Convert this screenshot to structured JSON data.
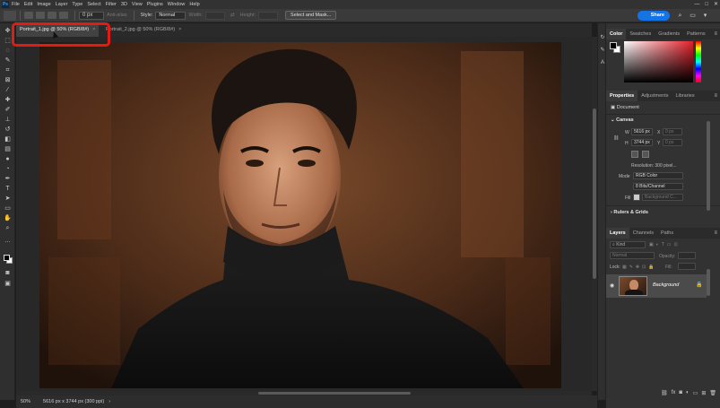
{
  "menu": {
    "logo": "Ps",
    "items": [
      "File",
      "Edit",
      "Image",
      "Layer",
      "Type",
      "Select",
      "Filter",
      "3D",
      "View",
      "Plugins",
      "Window",
      "Help"
    ],
    "window_controls": [
      "—",
      "□",
      "✕"
    ]
  },
  "options": {
    "feather_value": "0 px",
    "anti_alias": "Anti-alias",
    "style_label": "Style:",
    "style_value": "Normal",
    "width_label": "Width:",
    "height_label": "Height:",
    "select_mask": "Select and Mask...",
    "share": "Share"
  },
  "tabs": [
    {
      "label": "Portrait_1.jpg @ 50% (RGB/8#)",
      "close": "×"
    },
    {
      "label": "Portrait_2.jpg @ 50% (RGB/8#)",
      "close": "×"
    }
  ],
  "status": {
    "zoom": "50%",
    "doc_info": "5616 px x 3744 px (300 ppi)"
  },
  "color_panel": {
    "tabs": [
      "Color",
      "Swatches",
      "Gradients",
      "Patterns"
    ],
    "accent": "#e4202a"
  },
  "properties_panel": {
    "tabs": [
      "Properties",
      "Adjustments",
      "Libraries"
    ],
    "doc_label": "Document",
    "canvas_section": "Canvas",
    "w_label": "W",
    "w_value": "5616 px",
    "h_label": "H",
    "h_value": "3744 px",
    "x_label": "X",
    "x_value": "0 px",
    "y_label": "Y",
    "y_value": "0 px",
    "resolution": "Resolution: 300 pixel...",
    "mode_label": "Mode",
    "mode_value": "RGB Color",
    "depth_value": "8 Bits/Channel",
    "fill_label": "Fill",
    "fill_value": "Background C...",
    "rulers_section": "Rulers & Grids"
  },
  "layers_panel": {
    "tabs": [
      "Layers",
      "Channels",
      "Paths"
    ],
    "kind_placeholder": "Kind",
    "blend_mode": "Normal",
    "opacity_label": "Opacity:",
    "lock_label": "Lock:",
    "fill_label": "Fill:",
    "layer_name": "Background"
  }
}
